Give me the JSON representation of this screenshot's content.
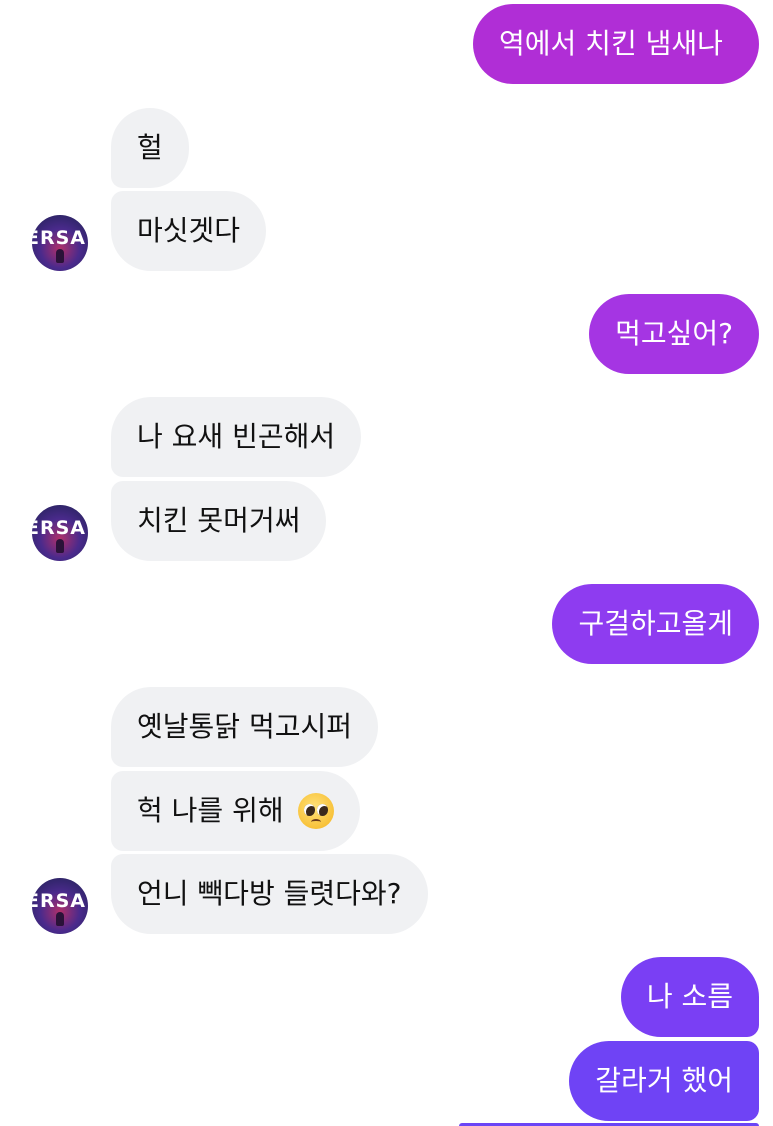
{
  "contact": {
    "avatar_text": "ERSA"
  },
  "messages": [
    {
      "from": "me",
      "text": "역에서 치킨 냄새나",
      "color": "#b02ed6"
    },
    {
      "from": "them",
      "text": "헐"
    },
    {
      "from": "them",
      "text": "마싯겟다"
    },
    {
      "from": "me",
      "text": "먹고싶어?",
      "color": "#a535e3"
    },
    {
      "from": "them",
      "text": "나 요새 빈곤해서"
    },
    {
      "from": "them",
      "text": "치킨 못머거써"
    },
    {
      "from": "me",
      "text": "구걸하고올게",
      "color": "#8e3cf0"
    },
    {
      "from": "them",
      "text": "옛날통닭 먹고시퍼"
    },
    {
      "from": "them",
      "text": "헉 나를 위해",
      "emoji": "pleading-face"
    },
    {
      "from": "them",
      "text": "언니 빽다방 들렷다와?"
    },
    {
      "from": "me",
      "text": "나 소름",
      "color": "#7a3ff4"
    },
    {
      "from": "me",
      "text": "갈라거 했어",
      "color": "#6f43f5"
    }
  ],
  "colors": {
    "incoming_bubble": "#f0f1f3",
    "incoming_text": "#111111",
    "outgoing_text": "#ffffff"
  }
}
